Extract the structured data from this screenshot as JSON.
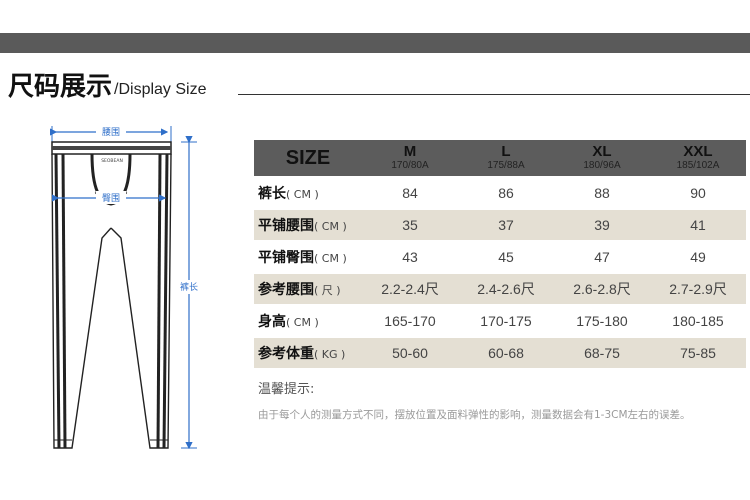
{
  "header": {
    "title_cn": "尺码展示",
    "title_en": "/Display Size"
  },
  "figure": {
    "waist_label": "腰围",
    "hip_label": "臀围",
    "length_label": "裤长",
    "brand_text": "SEOBEAN"
  },
  "table": {
    "size_header": "SIZE",
    "sizes": [
      {
        "name": "M",
        "code": "170/80A"
      },
      {
        "name": "L",
        "code": "175/88A"
      },
      {
        "name": "XL",
        "code": "180/96A"
      },
      {
        "name": "XXL",
        "code": "185/102A"
      }
    ],
    "rows": [
      {
        "label": "裤长",
        "unit": "( CM )",
        "values": [
          "84",
          "86",
          "88",
          "90"
        ]
      },
      {
        "label": "平铺腰围",
        "unit": "( CM )",
        "values": [
          "35",
          "37",
          "39",
          "41"
        ]
      },
      {
        "label": "平铺臀围",
        "unit": "( CM )",
        "values": [
          "43",
          "45",
          "47",
          "49"
        ]
      },
      {
        "label": "参考腰围",
        "unit": "( 尺 )",
        "values": [
          "2.2-2.4尺",
          "2.4-2.6尺",
          "2.6-2.8尺",
          "2.7-2.9尺"
        ]
      },
      {
        "label": "身高",
        "unit": "( CM )",
        "values": [
          "165-170",
          "170-175",
          "175-180",
          "180-185"
        ]
      },
      {
        "label": "参考体重",
        "unit": "( KG )",
        "values": [
          "50-60",
          "60-68",
          "68-75",
          "75-85"
        ]
      }
    ]
  },
  "tips": {
    "title": "温馨提示:",
    "body": "由于每个人的测量方式不同，摆放位置及面料弹性的影响，测量数据会有1-3CM左右的误差。"
  },
  "colors": {
    "top_bar": "#5a5a5a",
    "header_row": "#5c5c5c",
    "beige_row": "#e4dfd3",
    "measure_line": "#2f6fc9"
  }
}
